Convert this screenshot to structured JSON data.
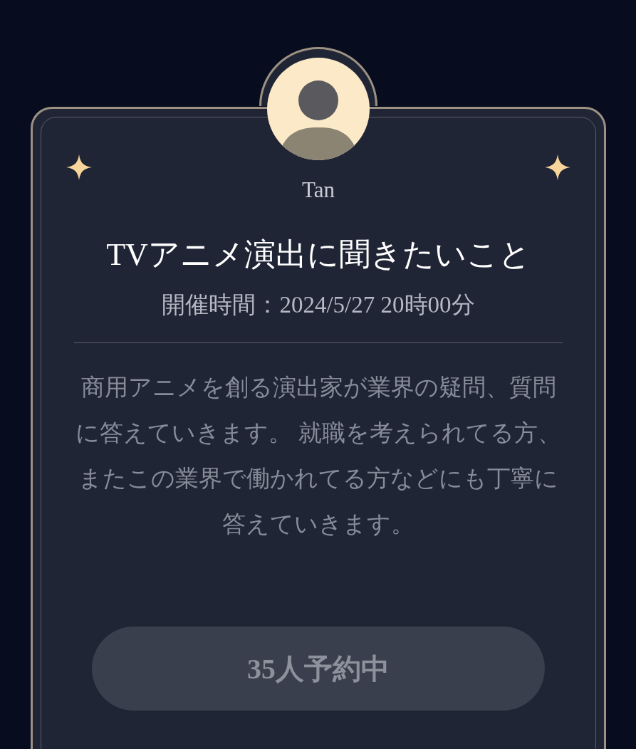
{
  "host": {
    "name": "Tan"
  },
  "event": {
    "title": "TVアニメ演出に聞きたいこと",
    "schedule": "開催時間：2024/5/27 20時00分",
    "description": "商用アニメを創る演出家が業界の疑問、質問に答えていきます。 就職を考えられてる方、またこの業界で働かれてる方などにも丁寧に答えていきます。"
  },
  "reserve_button": {
    "label": "35人予約中",
    "disabled": true
  }
}
